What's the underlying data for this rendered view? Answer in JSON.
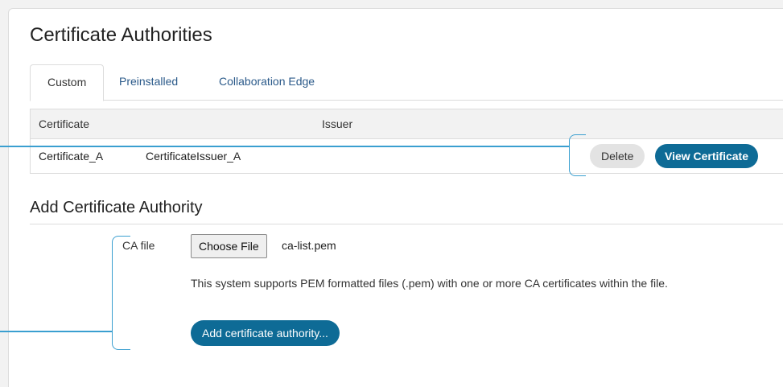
{
  "page": {
    "title": "Certificate Authorities"
  },
  "tabs": [
    {
      "label": "Custom",
      "active": true
    },
    {
      "label": "Preinstalled",
      "active": false
    },
    {
      "label": "Collaboration Edge",
      "active": false
    }
  ],
  "table": {
    "headers": {
      "certificate": "Certificate",
      "issuer": "Issuer"
    },
    "rows": [
      {
        "certificate": "Certificate_A",
        "issuer": "CertificateIssuer_A",
        "delete_label": "Delete",
        "view_label": "View Certificate"
      }
    ]
  },
  "add_section": {
    "title": "Add Certificate Authority",
    "ca_file_label": "CA file",
    "choose_file_label": "Choose File",
    "file_name": "ca-list.pem",
    "help_text": "This system supports PEM formatted files (.pem) with one or more CA certificates within the file.",
    "add_button_label": "Add certificate authority..."
  },
  "colors": {
    "accent": "#0e6b96",
    "callout": "#3a9fd0",
    "tab_link": "#2b5a8a"
  }
}
